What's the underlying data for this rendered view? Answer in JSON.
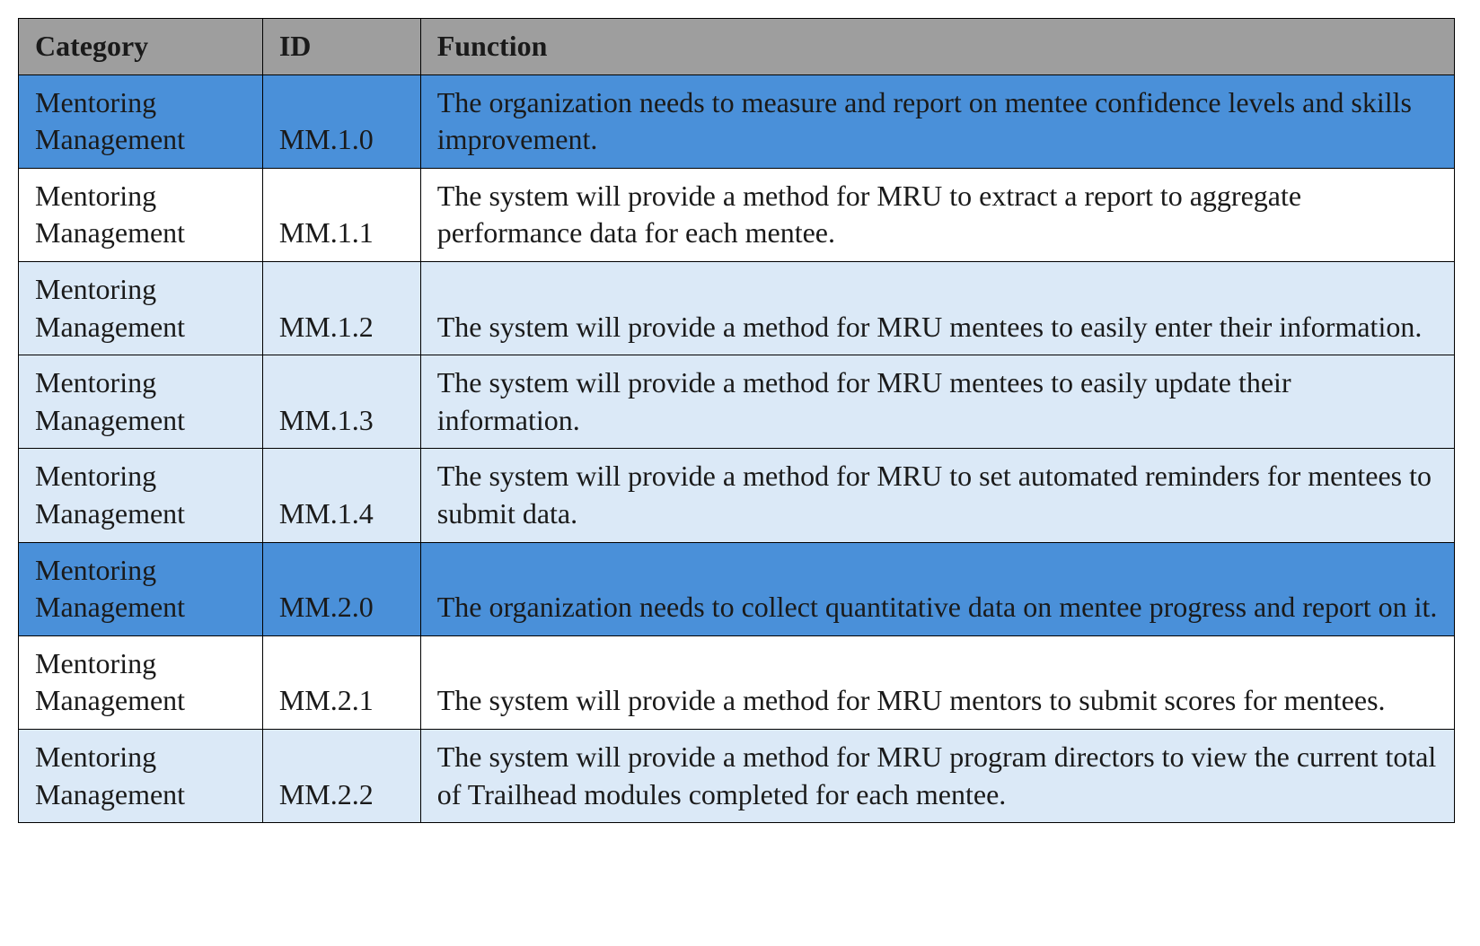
{
  "headers": {
    "category": "Category",
    "id": "ID",
    "function": "Function"
  },
  "rows": [
    {
      "style": "parent",
      "category": "Mentoring Management",
      "id": "MM.1.0",
      "function": "The organization needs to measure and report on mentee confidence levels and skills improvement."
    },
    {
      "style": "white",
      "category": "Mentoring Management",
      "id": "MM.1.1",
      "function": "The system will provide a method for MRU to extract a report to aggregate performance data for each mentee."
    },
    {
      "style": "light",
      "category": "Mentoring Management",
      "id": "MM.1.2",
      "function": "The system will provide a method for MRU mentees to easily enter their information."
    },
    {
      "style": "light",
      "category": "Mentoring Management",
      "id": "MM.1.3",
      "function": "The system will provide a method for MRU mentees to easily update their information."
    },
    {
      "style": "light",
      "category": "Mentoring Management",
      "id": "MM.1.4",
      "function": "The system will provide a method for MRU to set automated reminders for mentees to submit data."
    },
    {
      "style": "parent",
      "category": "Mentoring Management",
      "id": "MM.2.0",
      "function": "The organization needs to collect quantitative data on mentee progress and report on it."
    },
    {
      "style": "white",
      "category": "Mentoring Management",
      "id": "MM.2.1",
      "function": "The system will provide a method for MRU mentors to submit scores for mentees."
    },
    {
      "style": "light",
      "category": "Mentoring Management",
      "id": "MM.2.2",
      "function": "The system will provide a method for MRU program directors to view the current total of Trailhead modules completed for each mentee."
    }
  ]
}
